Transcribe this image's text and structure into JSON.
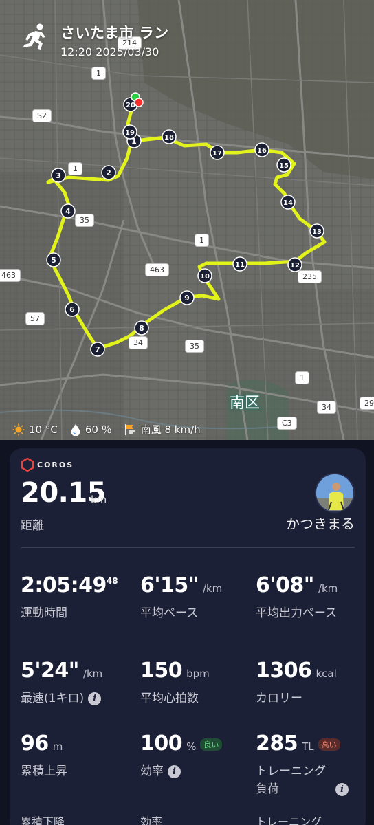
{
  "header": {
    "title": "さいたま市 ラン",
    "datetime": "12:20 2025/03/30"
  },
  "map": {
    "ward_label": "南区",
    "road_labels": [
      "214",
      "1",
      "S2",
      "1",
      "35",
      "1",
      "463",
      "463",
      "57",
      "34",
      "35",
      "235",
      "1",
      "34",
      "C3",
      "29"
    ],
    "km_markers": [
      "1",
      "2",
      "3",
      "4",
      "5",
      "6",
      "7",
      "8",
      "9",
      "10",
      "11",
      "12",
      "13",
      "14",
      "15",
      "16",
      "17",
      "18",
      "19",
      "20"
    ],
    "route_color": "#e2f21b"
  },
  "weather": {
    "temp": "10 °C",
    "humidity": "60 ％",
    "wind": "南風 8 km/h"
  },
  "card": {
    "brand": "COROS",
    "distance_value": "20.15",
    "distance_unit": "km",
    "distance_label": "距離",
    "username": "かつきまる",
    "metrics": {
      "moving_time_main": "2:05:49",
      "moving_time_sup": "48",
      "moving_time_label": "運動時間",
      "avg_pace_value": "6'15\"",
      "avg_pace_unit": "/km",
      "avg_pace_label": "平均ペース",
      "avg_power_pace_value": "6'08\"",
      "avg_power_pace_unit": "/km",
      "avg_power_pace_label": "平均出力ペース",
      "fastest_value": "5'24\"",
      "fastest_unit": "/km",
      "fastest_label": "最速(1キロ)",
      "hr_value": "150",
      "hr_unit": "bpm",
      "hr_label": "平均心拍数",
      "cal_value": "1306",
      "cal_unit": "kcal",
      "cal_label": "カロリー",
      "elev_value": "96",
      "elev_unit": "m",
      "elev_label": "累積上昇",
      "eff_value": "100",
      "eff_unit": "%",
      "eff_badge": "良い",
      "eff_label": "効率",
      "load_value": "285",
      "load_unit": "TL",
      "load_badge": "高い",
      "load_label_1": "トレーニング",
      "load_label_2": "負荷"
    },
    "cut_row": [
      "累積下降",
      "効率",
      "トレーニング"
    ]
  },
  "colors": {
    "card_bg": "#1c2036",
    "page_bg": "#101322",
    "badge_good": "#6fe08f",
    "badge_high": "#ff8f7a"
  }
}
